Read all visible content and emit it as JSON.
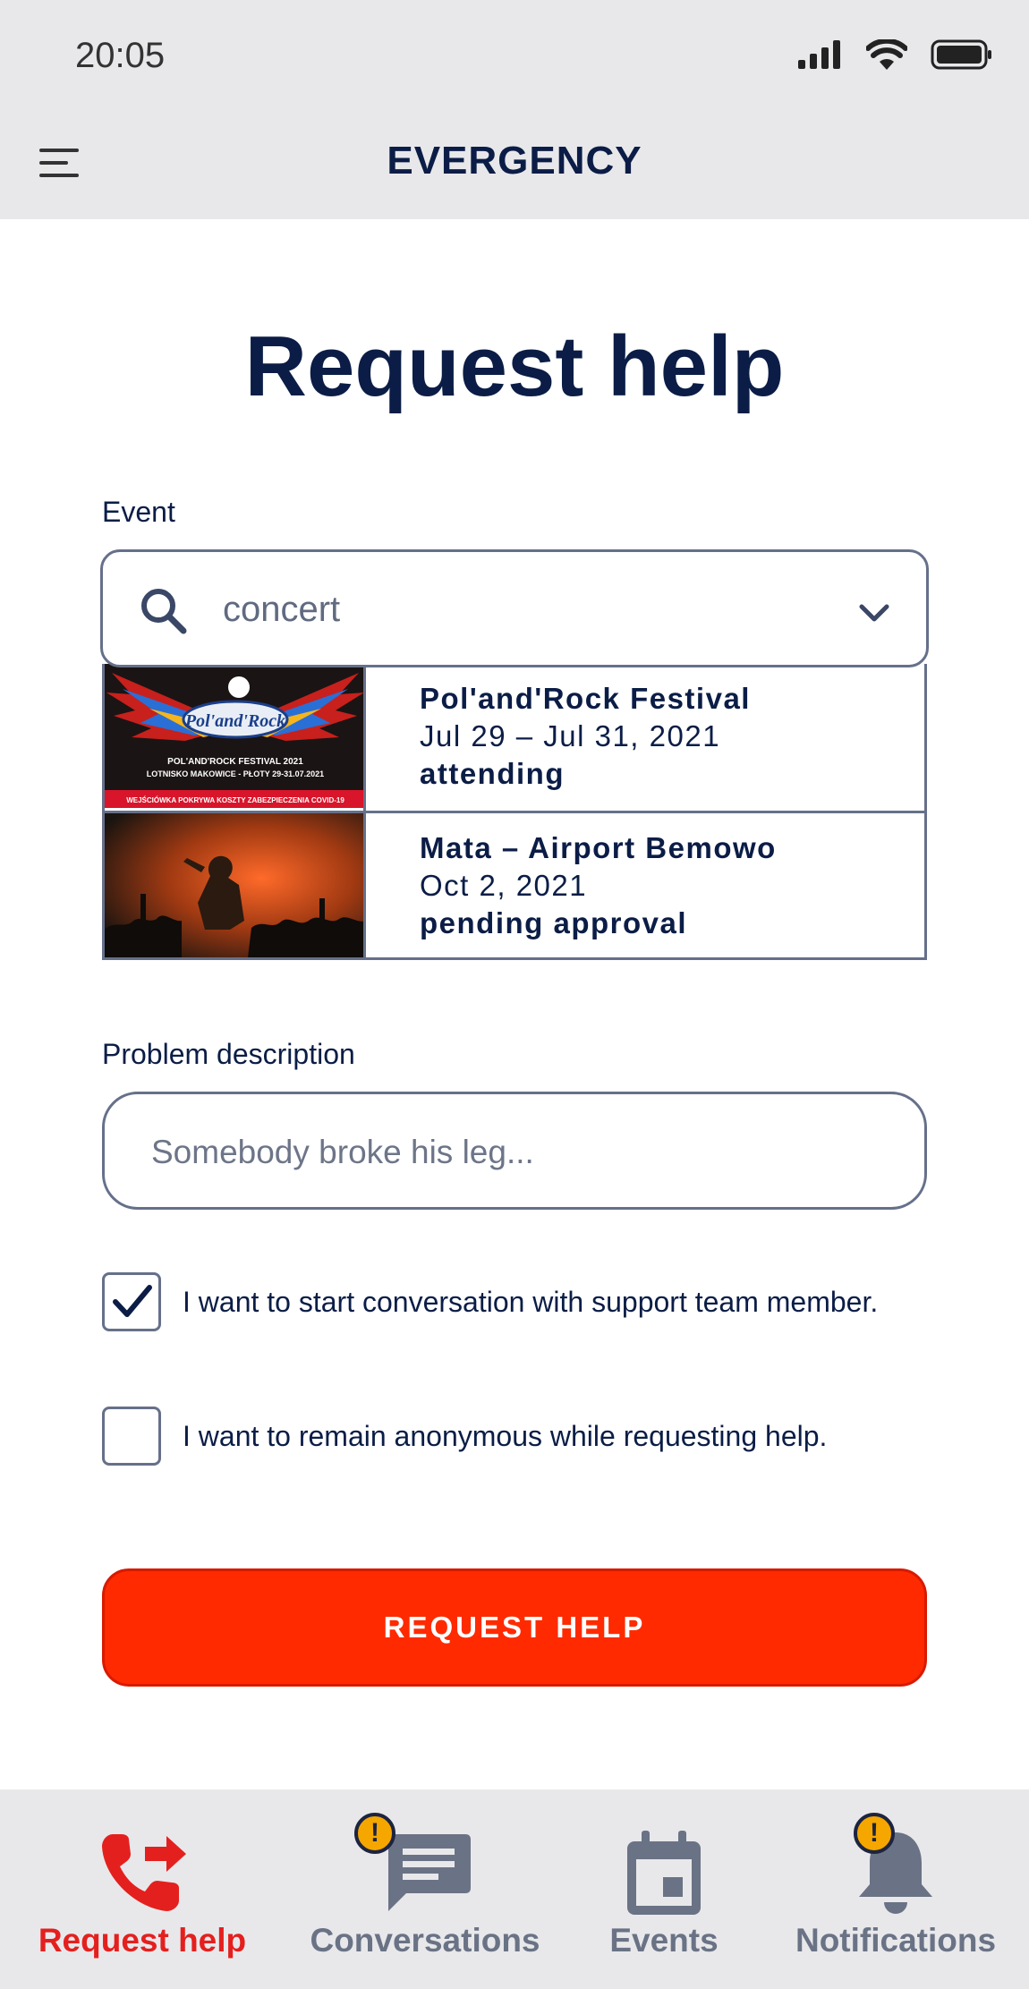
{
  "status_bar": {
    "time": "20:05"
  },
  "app_bar": {
    "title": "EVERGENCY"
  },
  "page": {
    "title": "Request help"
  },
  "event_field": {
    "label": "Event",
    "search_value": "concert",
    "results": [
      {
        "name": "Pol'and'Rock Festival",
        "dates": "Jul 29 – Jul 31, 2021",
        "status": "attending"
      },
      {
        "name": "Mata – Airport Bemowo",
        "dates": "Oct 2, 2021",
        "status": "pending approval"
      }
    ],
    "poster_text": {
      "logo": "Pol'and'Rock",
      "line1": "POL'AND'ROCK FESTIVAL 2021",
      "line2": "LOTNISKO MAKOWICE - PŁOTY 29-31.07.2021",
      "banner": "WEJŚCIÓWKA POKRYWA KOSZTY ZABEZPIECZENIA COVID-19"
    }
  },
  "problem_field": {
    "label": "Problem description",
    "placeholder": "Somebody broke his leg..."
  },
  "options": [
    {
      "label": "I want to start conversation with support team member.",
      "checked": true
    },
    {
      "label": "I want to remain anonymous while requesting help.",
      "checked": false
    }
  ],
  "submit": {
    "label": "REQUEST HELP"
  },
  "bottom_nav": [
    {
      "label": "Request help",
      "icon": "phone-forward-icon",
      "active": true,
      "badge": ""
    },
    {
      "label": "Conversations",
      "icon": "chat-icon",
      "active": false,
      "badge": "!"
    },
    {
      "label": "Events",
      "icon": "calendar-icon",
      "active": false,
      "badge": ""
    },
    {
      "label": "Notifications",
      "icon": "bell-icon",
      "active": false,
      "badge": "!"
    }
  ],
  "colors": {
    "primary": "#0b1d46",
    "accent": "#ff2a00",
    "nav_active": "#e4201e",
    "nav_inactive": "#6a7385",
    "badge": "#f5a700",
    "bar_bg": "#e8e8eb"
  }
}
